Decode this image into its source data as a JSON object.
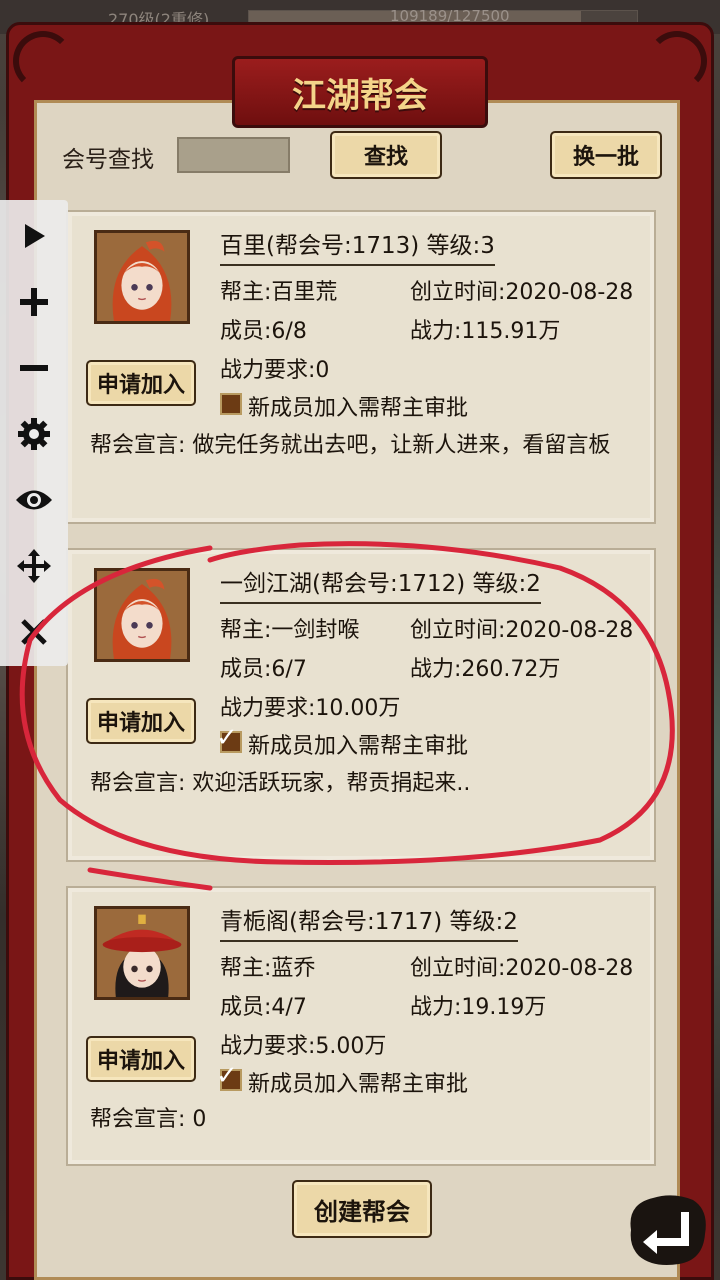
{
  "top_bar": {
    "level_text": "270级(2重修)",
    "exp_text": "109189/127500",
    "exp_fraction": 0.856
  },
  "panel": {
    "title": "江湖帮会"
  },
  "search": {
    "label": "会号查找",
    "input_value": "",
    "search_button": "查找",
    "refresh_button": "换一批"
  },
  "guilds": [
    {
      "title": "百里(帮会号:1713)  等级:3",
      "leader": "帮主:百里荒",
      "created": "创立时间:2020-08-28",
      "members": "成员:6/8",
      "power": "战力:115.91万",
      "power_req": "战力要求:0",
      "approval": "新成员加入需帮主审批",
      "approval_checked": false,
      "declaration": "帮会宣言: 做完任务就出去吧，让新人进来，看留言板",
      "join_button": "申请加入",
      "avatar": "female-warrior-avatar"
    },
    {
      "title": "一剑江湖(帮会号:1712)  等级:2",
      "leader": "帮主:一剑封喉",
      "created": "创立时间:2020-08-28",
      "members": "成员:6/7",
      "power": "战力:260.72万",
      "power_req": "战力要求:10.00万",
      "approval": "新成员加入需帮主审批",
      "approval_checked": true,
      "declaration": "帮会宣言: 欢迎活跃玩家，帮贡捐起来..",
      "join_button": "申请加入",
      "avatar": "female-warrior-avatar"
    },
    {
      "title": "青栀阁(帮会号:1717)  等级:2",
      "leader": "帮主:蓝乔",
      "created": "创立时间:2020-08-28",
      "members": "成员:4/7",
      "power": "战力:19.19万",
      "power_req": "战力要求:5.00万",
      "approval": "新成员加入需帮主审批",
      "approval_checked": true,
      "declaration": "帮会宣言: 0",
      "join_button": "申请加入",
      "avatar": "hat-girl-avatar"
    }
  ],
  "footer": {
    "create_button": "创建帮会"
  },
  "toolbar": {
    "icons": [
      "play-icon",
      "plus-icon",
      "minus-icon",
      "gear-icon",
      "eye-icon",
      "move-icon",
      "close-icon"
    ]
  },
  "colors": {
    "frame_red": "#7a1616",
    "title_gold": "#f4d48a",
    "annotation_red": "#d8263b",
    "parchment": "#ded5c2"
  }
}
